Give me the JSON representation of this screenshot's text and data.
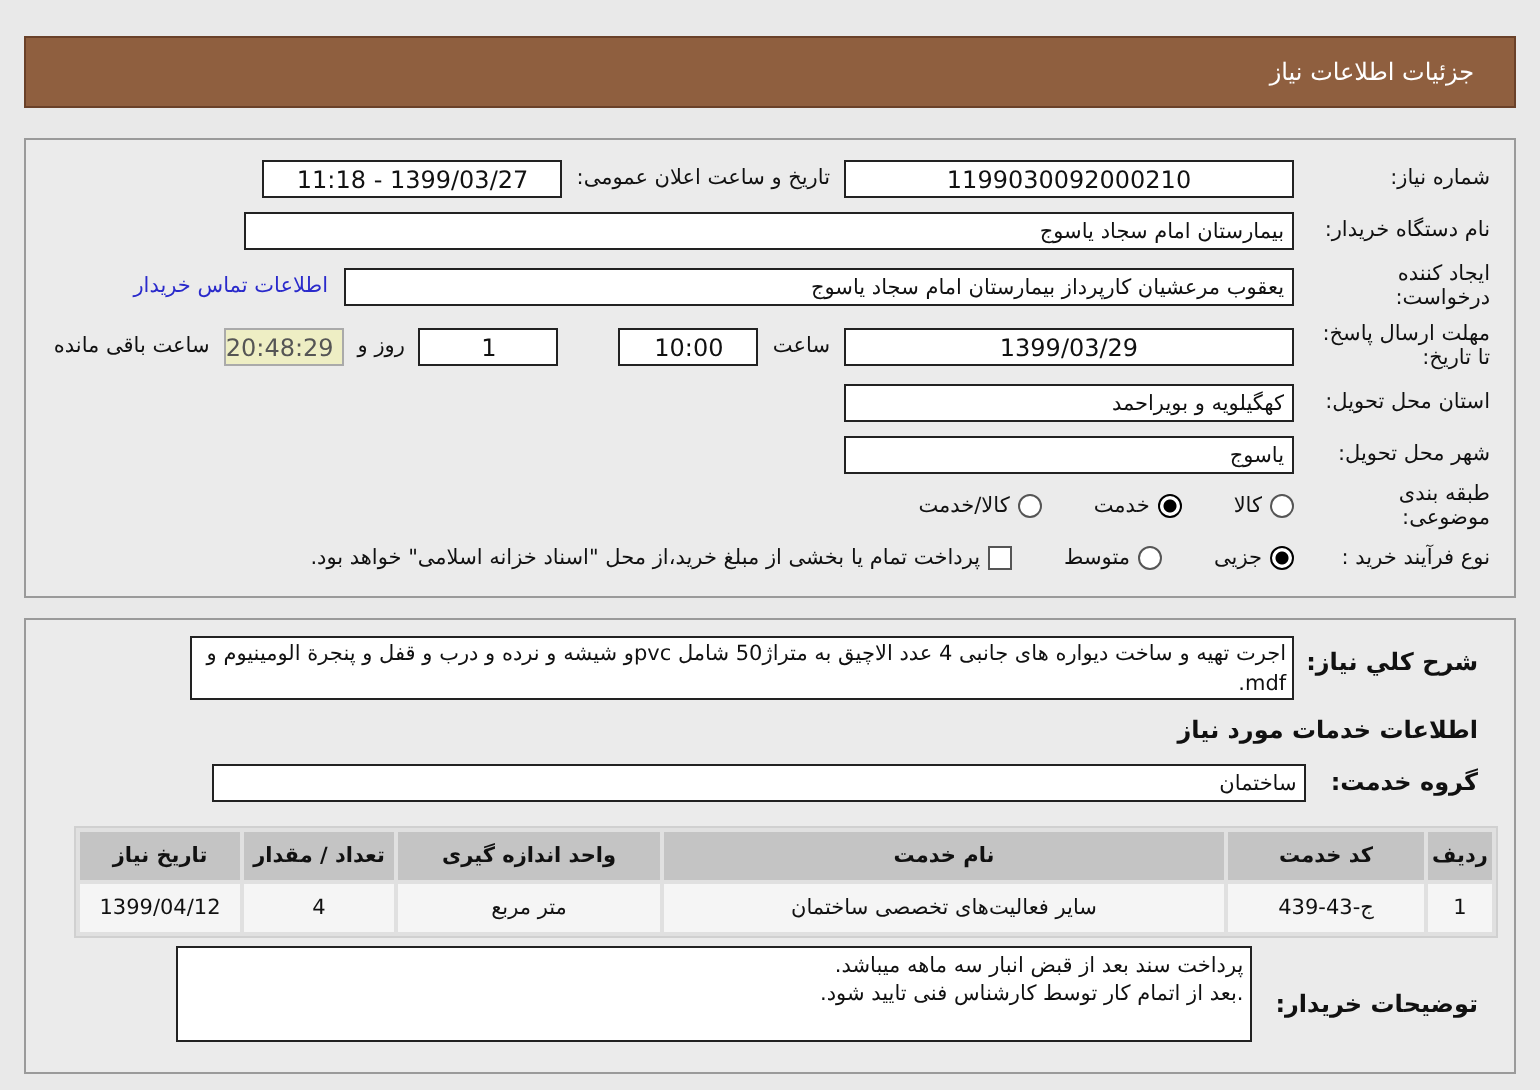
{
  "header": {
    "title": "جزئیات اطلاعات نیاز"
  },
  "details": {
    "need_number": {
      "label": "شماره نیاز:",
      "value": "1199030092000210"
    },
    "announce_datetime": {
      "label": "تاریخ و ساعت اعلان عمومی:",
      "value": "1399/03/27 - 11:18"
    },
    "buyer_org": {
      "label": "نام دستگاه خریدار:",
      "value": "بیمارستان امام سجاد یاسوج"
    },
    "requester": {
      "label": "ایجاد کننده درخواست:",
      "value": "یعقوب مرعشیان کارپرداز بیمارستان امام سجاد یاسوج",
      "link": "اطلاعات تماس خریدار"
    },
    "deadline": {
      "label": "مهلت ارسال پاسخ: تا تاریخ:",
      "date": "1399/03/29",
      "time_label": "ساعت",
      "time": "10:00",
      "days": "1",
      "days_label": "روز و",
      "remaining": "20:48:29",
      "remaining_label": "ساعت باقی مانده"
    },
    "province": {
      "label": "استان محل تحویل:",
      "value": "کهگیلویه و بویراحمد"
    },
    "city": {
      "label": "شهر محل تحویل:",
      "value": "یاسوج"
    },
    "category": {
      "label": "طبقه بندی موضوعی:",
      "options": [
        {
          "label": "کالا",
          "selected": false
        },
        {
          "label": "خدمت",
          "selected": true
        },
        {
          "label": "کالا/خدمت",
          "selected": false
        }
      ]
    },
    "process": {
      "label": "نوع فرآیند خرید :",
      "options": [
        {
          "label": "جزیی",
          "selected": true
        },
        {
          "label": "متوسط",
          "selected": false
        }
      ],
      "treasury": {
        "label": "پرداخت تمام یا بخشی از مبلغ خرید،از محل \"اسناد خزانه اسلامی\" خواهد بود.",
        "checked": false
      }
    }
  },
  "services": {
    "description": {
      "label": "شرح کلي نياز:",
      "value": "اجرت تهیه و ساخت دیواره های جانبی 4 عدد الاچیق به متراژ50 شامل pvcو شیشه و نرده و درب و قفل و پنجرة الومینیوم و mdf."
    },
    "heading": "اطلاعات خدمات مورد نیاز",
    "group": {
      "label": "گروه خدمت:",
      "value": "ساختمان"
    },
    "table": {
      "columns": [
        "ردیف",
        "کد خدمت",
        "نام خدمت",
        "واحد اندازه گیری",
        "تعداد / مقدار",
        "تاریخ نیاز"
      ],
      "rows": [
        [
          "1",
          "ج-43-439",
          "سایر فعالیت‌های تخصصی ساختمان",
          "متر مربع",
          "4",
          "1399/04/12"
        ]
      ]
    },
    "buyer_notes": {
      "label": "توضیحات خریدار:",
      "lines": [
        "پرداخت سند بعد از قبض انبار سه ماهه میباشد.",
        ".بعد از اتمام کار توسط کارشناس فنی تایید شود."
      ]
    }
  }
}
